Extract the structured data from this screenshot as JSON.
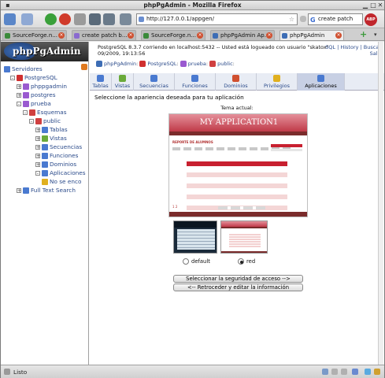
{
  "window": {
    "title": "phpPgAdmin - Mozilla Firefox"
  },
  "navbar": {
    "url": "http://127.0.0.1/appgen/",
    "search_placeholder": "create patch",
    "abp_label": "ABP"
  },
  "tabs": [
    {
      "label": "SourceForge.n...",
      "color": "#3a8a3a",
      "active": false
    },
    {
      "label": "create patch b...",
      "color": "#8a6ad0",
      "active": false
    },
    {
      "label": "SourceForge.n...",
      "color": "#3a8a3a",
      "active": false
    },
    {
      "label": "phpPgAdmin Ap...",
      "color": "#3d6db5",
      "active": false
    },
    {
      "label": "phpPgAdmin",
      "color": "#3d6db5",
      "active": true
    }
  ],
  "sidebar": {
    "logo": "phpPgAdmin",
    "tree": [
      {
        "label": "Servidores",
        "level": 0,
        "icon": "servers-icon",
        "color": "#4a7ad0",
        "expander": ""
      },
      {
        "label": "PostgreSQL",
        "level": 1,
        "icon": "server-icon",
        "color": "#d03030",
        "expander": "-"
      },
      {
        "label": "phppgadmin",
        "level": 2,
        "icon": "database-icon",
        "color": "#9a5ad0",
        "expander": "+"
      },
      {
        "label": "postgres",
        "level": 2,
        "icon": "database-icon",
        "color": "#9a5ad0",
        "expander": "+"
      },
      {
        "label": "prueba",
        "level": 2,
        "icon": "database-icon",
        "color": "#9a5ad0",
        "expander": "-"
      },
      {
        "label": "Esquemas",
        "level": 3,
        "icon": "schemas-icon",
        "color": "#d04040",
        "expander": "-"
      },
      {
        "label": "public",
        "level": 4,
        "icon": "schema-icon",
        "color": "#d04040",
        "expander": "-"
      },
      {
        "label": "Tablas",
        "level": 5,
        "icon": "tables-icon",
        "color": "#4a7ad0",
        "expander": "+"
      },
      {
        "label": "Vistas",
        "level": 5,
        "icon": "views-icon",
        "color": "#6aaa3a",
        "expander": "+"
      },
      {
        "label": "Secuencias",
        "level": 5,
        "icon": "sequences-icon",
        "color": "#4a7ad0",
        "expander": "+"
      },
      {
        "label": "Funciones",
        "level": 5,
        "icon": "functions-icon",
        "color": "#4a7ad0",
        "expander": "+"
      },
      {
        "label": "Dominios",
        "level": 5,
        "icon": "domains-icon",
        "color": "#4a7ad0",
        "expander": "+"
      },
      {
        "label": "Aplicaciones",
        "level": 5,
        "icon": "applications-icon",
        "color": "#4a7ad0",
        "expander": "-"
      },
      {
        "label": "No se enco",
        "level": 6,
        "icon": "warning-icon",
        "color": "#e0b020",
        "expander": ""
      },
      {
        "label": "Full Text Search",
        "level": 2,
        "icon": "fts-icon",
        "color": "#4a7ad0",
        "expander": "+"
      }
    ]
  },
  "main": {
    "server_info_line1": "PostgreSQL 8.3.7 corriendo en localhost:5432 -- Usted está logueado con usuario \"skatox\"",
    "server_info_line2": "09/2009, 19:13:56",
    "links": {
      "sql": "SQL",
      "history": "History",
      "search": "Buscar",
      "logout": "Salir"
    },
    "breadcrumb": [
      "phpPgAdmin",
      "PostgreSQL",
      "prueba",
      "public"
    ],
    "db_tabs": [
      {
        "label": "Tablas",
        "color": "#4a7ad0",
        "active": false
      },
      {
        "label": "Vistas",
        "color": "#6aaa3a",
        "active": false
      },
      {
        "label": "Secuencias",
        "color": "#4a7ad0",
        "active": false
      },
      {
        "label": "Funciones",
        "color": "#4a7ad0",
        "active": false
      },
      {
        "label": "Dominios",
        "color": "#d05030",
        "active": false
      },
      {
        "label": "Privilegios",
        "color": "#e0b020",
        "active": false
      },
      {
        "label": "Aplicaciones",
        "color": "#4a7ad0",
        "active": true
      }
    ],
    "prompt": "Seleccione la apariencia deseada para tu aplicación",
    "current_theme_label": "Tema actual:",
    "preview": {
      "title": "MY APPLICATION1",
      "report_title": "REPORTE DE ALUMNOS",
      "pager": "1 2"
    },
    "themes": [
      {
        "label": "default",
        "selected": false
      },
      {
        "label": "red",
        "selected": true
      }
    ],
    "button_next": "Seleccionar la seguridad de acceso -->",
    "button_back": "<-- Retroceder y editar la información"
  },
  "status": {
    "text": "Listo"
  }
}
